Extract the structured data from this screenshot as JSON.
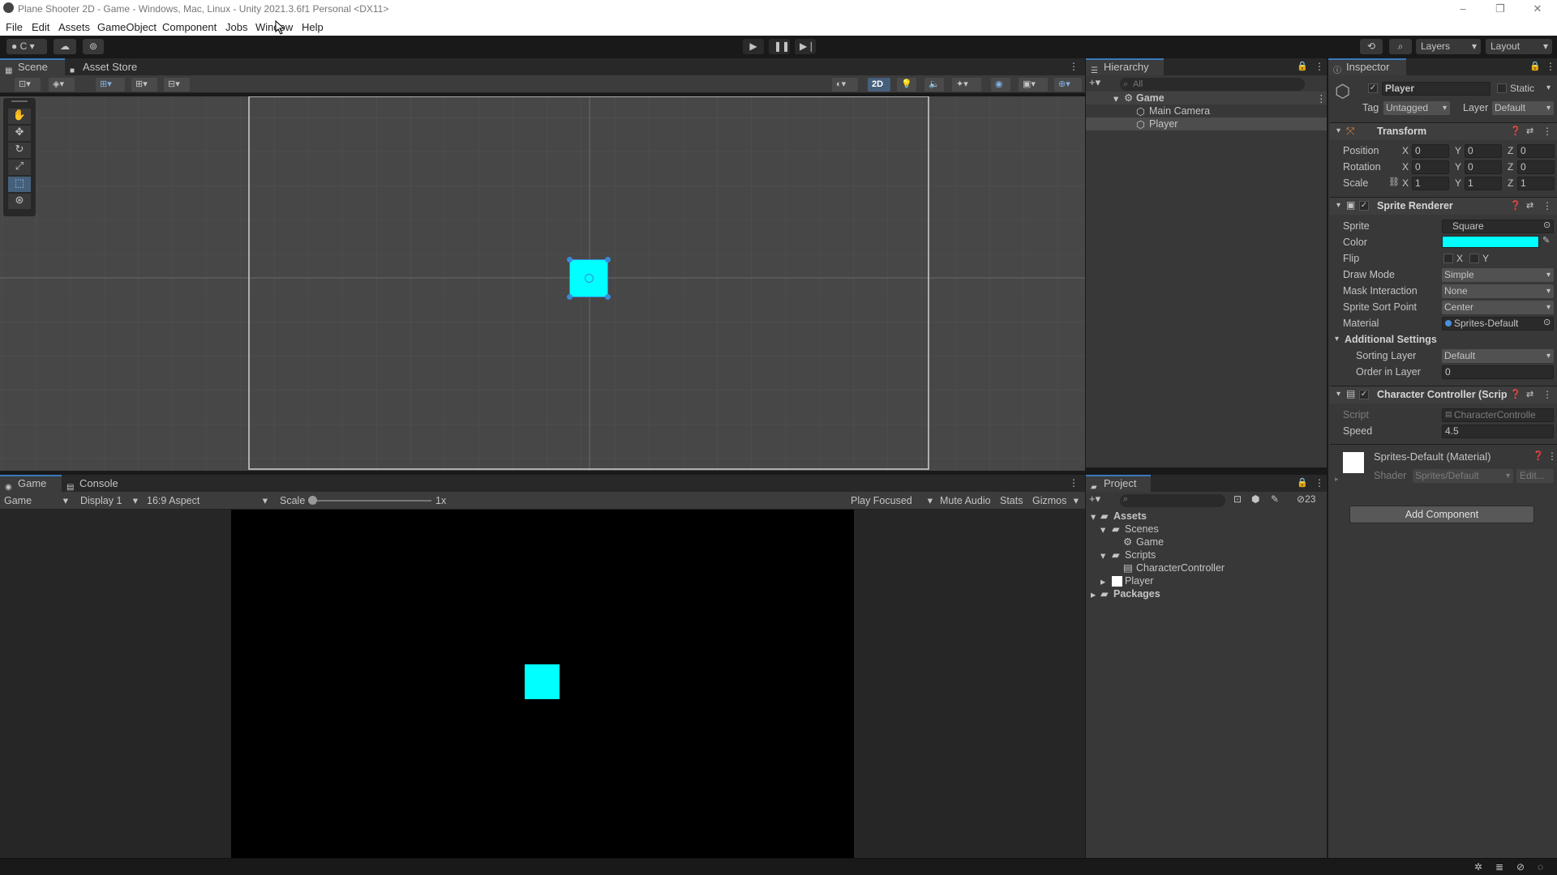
{
  "window": {
    "title": "Plane Shooter 2D - Game - Windows, Mac, Linux - Unity 2021.3.6f1 Personal <DX11>"
  },
  "menu": [
    "File",
    "Edit",
    "Assets",
    "GameObject",
    "Component",
    "Jobs",
    "Window",
    "Help"
  ],
  "toolbar": {
    "account": "C",
    "layers": "Layers",
    "layout": "Layout"
  },
  "scene_tabs": {
    "scene": "Scene",
    "asset_store": "Asset Store",
    "mode_2d": "2D"
  },
  "game_tabs": {
    "game": "Game",
    "console": "Console"
  },
  "game_bar": {
    "mode": "Game",
    "display": "Display 1",
    "aspect": "16:9 Aspect",
    "scale_label": "Scale",
    "scale_value": "1x",
    "play_focused": "Play Focused",
    "mute": "Mute Audio",
    "stats": "Stats",
    "gizmos": "Gizmos"
  },
  "hierarchy": {
    "title": "Hierarchy",
    "search_placeholder": "All",
    "scene": "Game",
    "items": [
      "Main Camera",
      "Player"
    ]
  },
  "project": {
    "title": "Project",
    "hidden_count": "23",
    "assets": "Assets",
    "scenes": "Scenes",
    "scene_game": "Game",
    "scripts": "Scripts",
    "script_cc": "CharacterController",
    "player": "Player",
    "packages": "Packages"
  },
  "inspector": {
    "title": "Inspector",
    "object_name": "Player",
    "static_label": "Static",
    "tag_label": "Tag",
    "tag": "Untagged",
    "layer_label": "Layer",
    "layer": "Default",
    "transform": {
      "title": "Transform",
      "position": "Position",
      "rotation": "Rotation",
      "scale": "Scale",
      "pos": [
        "0",
        "0",
        "0"
      ],
      "rot": [
        "0",
        "0",
        "0"
      ],
      "scl": [
        "1",
        "1",
        "1"
      ],
      "axes": [
        "X",
        "Y",
        "Z"
      ]
    },
    "sprite_renderer": {
      "title": "Sprite Renderer",
      "sprite_label": "Sprite",
      "sprite": "Square",
      "color_label": "Color",
      "color": "#00ffff",
      "flip_label": "Flip",
      "flip_x": "X",
      "flip_y": "Y",
      "draw_mode_label": "Draw Mode",
      "draw_mode": "Simple",
      "mask_label": "Mask Interaction",
      "mask": "None",
      "sort_point_label": "Sprite Sort Point",
      "sort_point": "Center",
      "material_label": "Material",
      "material": "Sprites-Default",
      "additional": "Additional Settings",
      "sorting_layer_label": "Sorting Layer",
      "sorting_layer": "Default",
      "order_label": "Order in Layer",
      "order": "0"
    },
    "character_controller": {
      "title": "Character Controller (Scrip",
      "script_label": "Script",
      "script": "CharacterControlle",
      "speed_label": "Speed",
      "speed": "4.5"
    },
    "material": {
      "title": "Sprites-Default (Material)",
      "shader_label": "Shader",
      "shader": "Sprites/Default",
      "edit": "Edit..."
    },
    "add_component": "Add Component"
  },
  "colors": {
    "accent": "#3a79bb",
    "sprite": "#00ffff",
    "selection": "#2c5d87"
  }
}
